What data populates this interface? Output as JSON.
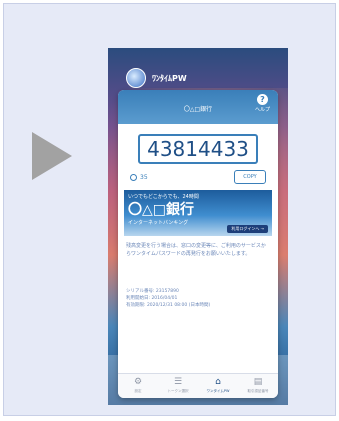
{
  "app": {
    "title": "ﾜﾝﾀｲﾑPW"
  },
  "header": {
    "bank_name": "〇△□銀行",
    "help_icon": "?",
    "help_label": "ヘルプ"
  },
  "otp": {
    "code": "43814433",
    "timer": "35",
    "copy_label": "COPY"
  },
  "banner": {
    "line1": "いつでもどこからでも、24時間",
    "line2": "〇△□銀行",
    "line3": "インターネットバンキング",
    "button": "利用ログインへ →"
  },
  "notice": "残高変更を行う場合は、窓口の変更等に、ご利用のサービスからワンタイムパスワードの再発行をお願いいたします。",
  "meta": {
    "serial": "シリアル番号: 23157890",
    "start_date": "利用開始日: 2016/04/01",
    "expiry": "有効期限: 2020/12/31 08:00 (日本時間)"
  },
  "tabs": [
    {
      "label": "設定",
      "icon": "gear-icon",
      "glyph": "⚙"
    },
    {
      "label": "トークン選択",
      "icon": "list-icon",
      "glyph": "☰"
    },
    {
      "label": "ワンタイムPW",
      "icon": "bank-icon",
      "glyph": "⌂"
    },
    {
      "label": "取引認証番号",
      "icon": "document-icon",
      "glyph": "▤"
    }
  ],
  "active_tab": 2,
  "colors": {
    "accent": "#3a7fb9",
    "brand_dark": "#1f4f86",
    "frame_bg": "#e6eaf7",
    "arrow": "#a2a2a2"
  }
}
